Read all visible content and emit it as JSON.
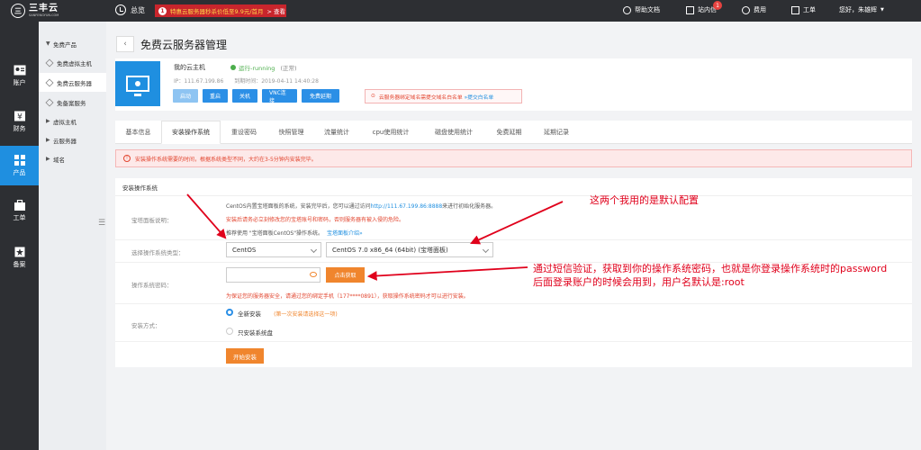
{
  "brand": {
    "logo_mark": "三",
    "name": "三丰云",
    "sub": "SANFENGYUN.COM"
  },
  "topbar": {
    "overview": "总览",
    "promo_num": "1",
    "promo_text": "特惠云服务器秒杀价低至9.9元/首月",
    "promo_link": "> 查看",
    "help": "帮助文档",
    "messages": "站内信",
    "messages_badge": "1",
    "billing": "费用",
    "tickets": "工单",
    "greeting": "您好，朱雄辉"
  },
  "rail": [
    {
      "label": "账户",
      "icon": "user-card-icon"
    },
    {
      "label": "财务",
      "icon": "yen-icon"
    },
    {
      "label": "产品",
      "icon": "grid-icon"
    },
    {
      "label": "工单",
      "icon": "briefcase-icon"
    },
    {
      "label": "备案",
      "icon": "record-icon"
    }
  ],
  "sidebar": {
    "items": [
      {
        "label": "免费产品",
        "kind": "group"
      },
      {
        "label": "免费虚拟主机",
        "kind": "sub"
      },
      {
        "label": "免费云服务器",
        "kind": "sub"
      },
      {
        "label": "免备案服务",
        "kind": "sub"
      },
      {
        "label": "虚拟主机",
        "kind": "group"
      },
      {
        "label": "云服务器",
        "kind": "group"
      },
      {
        "label": "域名",
        "kind": "group"
      }
    ],
    "collapse_glyph": "☰"
  },
  "page": {
    "back": "‹",
    "title": "免费云服务器管理"
  },
  "server": {
    "name": "我的云主机",
    "status": "运行-running",
    "status_note": "(正常)",
    "ip": "IP：111.67.199.86",
    "expire": "到期时间：2019-04-11 14:40:28",
    "buttons": [
      "启动",
      "重启",
      "关机",
      "VNC连接",
      "免费延期"
    ],
    "notice": "云服务器绑定域名需提交域名白名单",
    "notice_link": "»提交白名单"
  },
  "tabs": [
    "基本信息",
    "安装操作系统",
    "重设密码",
    "快照管理",
    "流量统计",
    "cpu使用统计",
    "磁盘使用统计",
    "免费延期",
    "延期记录"
  ],
  "alert": {
    "icon": "!",
    "text": "安装操作系统需要的时间，根据系统类型不同，大约在3-5分钟内安装完毕。"
  },
  "install": {
    "section_title": "安装操作系统",
    "panel_label": "宝塔面板说明：",
    "desc1_a": "CentOS内置宝塔面板的系统，安装完毕后，您可以通过访问",
    "desc1_link": "http://111.67.199.86:8888",
    "desc1_b": "来进行初始化服务器。",
    "desc2": "安装后请务必立刻修改您的宝塔账号和密码，否则服务器有被入侵的危险。",
    "desc3_a": "推荐使用 \"宝塔面板CentOS\"操作系统。",
    "desc3_link": "宝塔面板介绍»",
    "os_type_label": "选择操作系统类型：",
    "os_type": "CentOS",
    "os_version": "CentOS 7.0 x86_64 (64bit) (宝塔面板)",
    "password_label": "操作系统密码：",
    "get_code": "点击获取",
    "sms_note": "为保证您的服务器安全，请通过您的绑定手机（177****0891），获取操作系统密码才可以进行安装。",
    "mode_label": "安装方式：",
    "mode_full": "全新安装",
    "mode_full_note": "(第一次安装请选择这一项)",
    "mode_sys": "只安装系统盘",
    "start": "开始安装"
  },
  "annotations": {
    "default_config": "这两个我用的是默认配置",
    "sms_line1": "通过短信验证，获取到你的操作系统密码，也就是你登录操作系统时的password",
    "sms_line2": "后面登录账户的时候会用到，用户名默认是:root"
  },
  "colors": {
    "dark": "#2d2f33",
    "accent": "#1f8fe0",
    "orange": "#f0852d",
    "annotation": "#e0001b"
  }
}
